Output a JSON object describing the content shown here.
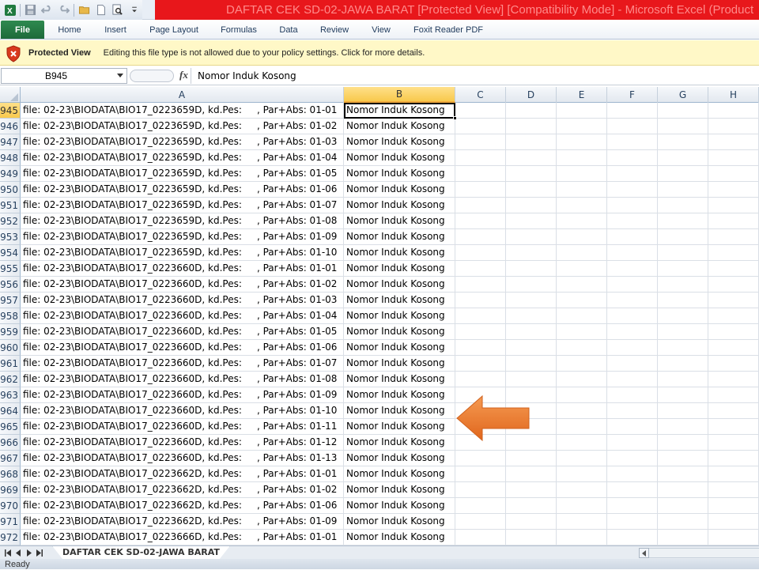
{
  "window": {
    "title": "DAFTAR CEK SD-02-JAWA BARAT  [Protected View]  [Compatibility Mode]  -  Microsoft Excel (Product"
  },
  "quick_access": {
    "icons": [
      "excel-icon",
      "save-icon",
      "undo-icon",
      "redo-icon",
      "open-icon",
      "new-icon",
      "print-preview-icon",
      "customize-icon"
    ]
  },
  "ribbon": {
    "file_label": "File",
    "tabs": [
      "Home",
      "Insert",
      "Page Layout",
      "Formulas",
      "Data",
      "Review",
      "View",
      "Foxit Reader PDF"
    ]
  },
  "protected_view": {
    "title": "Protected View",
    "message": "Editing this file type is not allowed due to your policy settings.  Click for more details."
  },
  "formula_bar": {
    "name_box": "B945",
    "fx_label": "fx",
    "content": "Nomor Induk Kosong"
  },
  "columns": [
    "A",
    "B",
    "C",
    "D",
    "E",
    "F",
    "G",
    "H"
  ],
  "selected_column": "B",
  "selected_row": "945",
  "rows": [
    {
      "num": "945",
      "a": "file: 02-23\\BIODATA\\BIO17_0223659D, kd.Pes:     , Par+Abs: 01-01",
      "b": "Nomor Induk Kosong"
    },
    {
      "num": "946",
      "a": "file: 02-23\\BIODATA\\BIO17_0223659D, kd.Pes:     , Par+Abs: 01-02",
      "b": "Nomor Induk Kosong"
    },
    {
      "num": "947",
      "a": "file: 02-23\\BIODATA\\BIO17_0223659D, kd.Pes:     , Par+Abs: 01-03",
      "b": "Nomor Induk Kosong"
    },
    {
      "num": "948",
      "a": "file: 02-23\\BIODATA\\BIO17_0223659D, kd.Pes:     , Par+Abs: 01-04",
      "b": "Nomor Induk Kosong"
    },
    {
      "num": "949",
      "a": "file: 02-23\\BIODATA\\BIO17_0223659D, kd.Pes:     , Par+Abs: 01-05",
      "b": "Nomor Induk Kosong"
    },
    {
      "num": "950",
      "a": "file: 02-23\\BIODATA\\BIO17_0223659D, kd.Pes:     , Par+Abs: 01-06",
      "b": "Nomor Induk Kosong"
    },
    {
      "num": "951",
      "a": "file: 02-23\\BIODATA\\BIO17_0223659D, kd.Pes:     , Par+Abs: 01-07",
      "b": "Nomor Induk Kosong"
    },
    {
      "num": "952",
      "a": "file: 02-23\\BIODATA\\BIO17_0223659D, kd.Pes:     , Par+Abs: 01-08",
      "b": "Nomor Induk Kosong"
    },
    {
      "num": "953",
      "a": "file: 02-23\\BIODATA\\BIO17_0223659D, kd.Pes:     , Par+Abs: 01-09",
      "b": "Nomor Induk Kosong"
    },
    {
      "num": "954",
      "a": "file: 02-23\\BIODATA\\BIO17_0223659D, kd.Pes:     , Par+Abs: 01-10",
      "b": "Nomor Induk Kosong"
    },
    {
      "num": "955",
      "a": "file: 02-23\\BIODATA\\BIO17_0223660D, kd.Pes:     , Par+Abs: 01-01",
      "b": "Nomor Induk Kosong"
    },
    {
      "num": "956",
      "a": "file: 02-23\\BIODATA\\BIO17_0223660D, kd.Pes:     , Par+Abs: 01-02",
      "b": "Nomor Induk Kosong"
    },
    {
      "num": "957",
      "a": "file: 02-23\\BIODATA\\BIO17_0223660D, kd.Pes:     , Par+Abs: 01-03",
      "b": "Nomor Induk Kosong"
    },
    {
      "num": "958",
      "a": "file: 02-23\\BIODATA\\BIO17_0223660D, kd.Pes:     , Par+Abs: 01-04",
      "b": "Nomor Induk Kosong"
    },
    {
      "num": "959",
      "a": "file: 02-23\\BIODATA\\BIO17_0223660D, kd.Pes:     , Par+Abs: 01-05",
      "b": "Nomor Induk Kosong"
    },
    {
      "num": "960",
      "a": "file: 02-23\\BIODATA\\BIO17_0223660D, kd.Pes:     , Par+Abs: 01-06",
      "b": "Nomor Induk Kosong"
    },
    {
      "num": "961",
      "a": "file: 02-23\\BIODATA\\BIO17_0223660D, kd.Pes:     , Par+Abs: 01-07",
      "b": "Nomor Induk Kosong"
    },
    {
      "num": "962",
      "a": "file: 02-23\\BIODATA\\BIO17_0223660D, kd.Pes:     , Par+Abs: 01-08",
      "b": "Nomor Induk Kosong"
    },
    {
      "num": "963",
      "a": "file: 02-23\\BIODATA\\BIO17_0223660D, kd.Pes:     , Par+Abs: 01-09",
      "b": "Nomor Induk Kosong"
    },
    {
      "num": "964",
      "a": "file: 02-23\\BIODATA\\BIO17_0223660D, kd.Pes:     , Par+Abs: 01-10",
      "b": "Nomor Induk Kosong"
    },
    {
      "num": "965",
      "a": "file: 02-23\\BIODATA\\BIO17_0223660D, kd.Pes:     , Par+Abs: 01-11",
      "b": "Nomor Induk Kosong"
    },
    {
      "num": "966",
      "a": "file: 02-23\\BIODATA\\BIO17_0223660D, kd.Pes:     , Par+Abs: 01-12",
      "b": "Nomor Induk Kosong"
    },
    {
      "num": "967",
      "a": "file: 02-23\\BIODATA\\BIO17_0223660D, kd.Pes:     , Par+Abs: 01-13",
      "b": "Nomor Induk Kosong"
    },
    {
      "num": "968",
      "a": "file: 02-23\\BIODATA\\BIO17_0223662D, kd.Pes:     , Par+Abs: 01-01",
      "b": "Nomor Induk Kosong"
    },
    {
      "num": "969",
      "a": "file: 02-23\\BIODATA\\BIO17_0223662D, kd.Pes:     , Par+Abs: 01-02",
      "b": "Nomor Induk Kosong"
    },
    {
      "num": "970",
      "a": "file: 02-23\\BIODATA\\BIO17_0223662D, kd.Pes:     , Par+Abs: 01-06",
      "b": "Nomor Induk Kosong"
    },
    {
      "num": "971",
      "a": "file: 02-23\\BIODATA\\BIO17_0223662D, kd.Pes:     , Par+Abs: 01-09",
      "b": "Nomor Induk Kosong"
    },
    {
      "num": "972",
      "a": "file: 02-23\\BIODATA\\BIO17_0223666D, kd.Pes:     , Par+Abs: 01-01",
      "b": "Nomor Induk Kosong"
    }
  ],
  "sheet_tab": "DAFTAR CEK SD-02-JAWA BARAT",
  "status": "Ready",
  "colors": {
    "title_bar": "#e8171b",
    "file_tab": "#207245",
    "protected_bar": "#fff8c7",
    "selection_header": "#f8c94c",
    "annotation_arrow": "#ee7d2e"
  }
}
